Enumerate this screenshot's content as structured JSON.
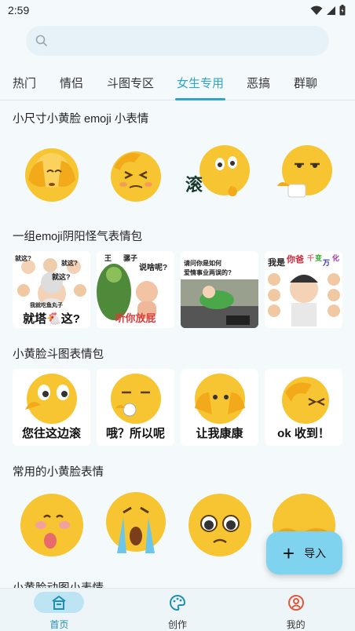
{
  "status": {
    "time": "2:59"
  },
  "search": {
    "placeholder": ""
  },
  "tabs": [
    {
      "label": "热门"
    },
    {
      "label": "情侣"
    },
    {
      "label": "斗图专区"
    },
    {
      "label": "女生专用"
    },
    {
      "label": "恶搞"
    },
    {
      "label": "群聊"
    }
  ],
  "sections": [
    {
      "title": "小尺寸小黄脸 emoji 小表情"
    },
    {
      "title": "一组emoji阴阳怪气表情包"
    },
    {
      "title": "小黄脸斗图表情包"
    },
    {
      "title": "常用的小黄脸表情"
    },
    {
      "title": "小黄脸动图小表情"
    }
  ],
  "stickers_row1": [
    {
      "text": ""
    },
    {
      "text": ""
    },
    {
      "text": "滚"
    },
    {
      "text": ""
    }
  ],
  "stickers_row2": [
    {
      "lines": [
        "就这?",
        "就这?",
        "就这?"
      ],
      "caption": "就塔🐔这?",
      "extra": "我就吃鱼丸子"
    },
    {
      "lines": [
        "王",
        "骡子",
        "说啥呢?"
      ],
      "caption": "听你放屁"
    },
    {
      "lines": [
        "请问你是如何",
        "爱情事业两误的?"
      ],
      "caption": ""
    },
    {
      "lines": [
        "我是",
        "你爸",
        "千",
        "变",
        "万",
        "化"
      ],
      "caption": ""
    }
  ],
  "stickers_row3": [
    {
      "caption": "您往这边滚"
    },
    {
      "caption": "哦？所以呢"
    },
    {
      "caption": "让我康康"
    },
    {
      "caption": "ok 收到！"
    }
  ],
  "fab": {
    "label": "导入"
  },
  "nav": [
    {
      "label": "首页",
      "icon": "home-icon"
    },
    {
      "label": "创作",
      "icon": "palette-icon"
    },
    {
      "label": "我的",
      "icon": "profile-icon"
    }
  ],
  "colors": {
    "accent": "#2fa6c9",
    "face": "#f7c531",
    "fab": "#7fd3ee",
    "nav_active": "#bde4f3"
  }
}
